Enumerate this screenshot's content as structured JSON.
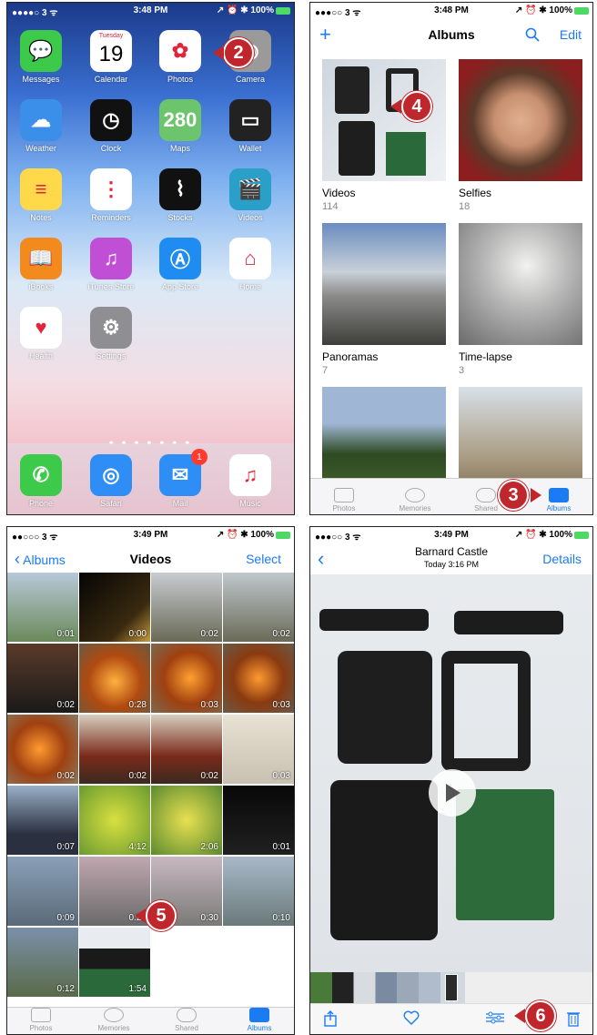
{
  "home": {
    "status": {
      "carrier": "●●●●○ 3 ᯤ",
      "time": "3:48 PM",
      "right": "↗ ⏰ ✱ 100%"
    },
    "apps": [
      {
        "label": "Messages",
        "icon": "messages-icon",
        "glyph": "💬",
        "color": "#3dc94a"
      },
      {
        "label": "Calendar",
        "icon": "calendar-icon",
        "glyph": "19",
        "color": "#ffffff"
      },
      {
        "label": "Photos",
        "icon": "photos-icon",
        "glyph": "✿",
        "color": "#ffffff"
      },
      {
        "label": "Camera",
        "icon": "camera-icon",
        "glyph": "◉",
        "color": "#9a9a9a"
      },
      {
        "label": "Weather",
        "icon": "weather-icon",
        "glyph": "☁",
        "color": "#3b8fe8"
      },
      {
        "label": "Clock",
        "icon": "clock-icon",
        "glyph": "◷",
        "color": "#111111"
      },
      {
        "label": "Maps",
        "icon": "maps-icon",
        "glyph": "280",
        "color": "#6cc56c"
      },
      {
        "label": "Wallet",
        "icon": "wallet-icon",
        "glyph": "▭",
        "color": "#222222"
      },
      {
        "label": "Notes",
        "icon": "notes-icon",
        "glyph": "≡",
        "color": "#ffd94a"
      },
      {
        "label": "Reminders",
        "icon": "reminders-icon",
        "glyph": "⋮",
        "color": "#ffffff"
      },
      {
        "label": "Stocks",
        "icon": "stocks-icon",
        "glyph": "⌇",
        "color": "#111111"
      },
      {
        "label": "Videos",
        "icon": "videos-icon",
        "glyph": "🎬",
        "color": "#2aa0c8"
      },
      {
        "label": "iBooks",
        "icon": "ibooks-icon",
        "glyph": "📖",
        "color": "#f38a1e"
      },
      {
        "label": "iTunes Store",
        "icon": "itunes-store-icon",
        "glyph": "♫",
        "color": "#c04fd6"
      },
      {
        "label": "App Store",
        "icon": "app-store-icon",
        "glyph": "Ⓐ",
        "color": "#1e8cf0"
      },
      {
        "label": "Home",
        "icon": "home-icon",
        "glyph": "⌂",
        "color": "#ffffff"
      },
      {
        "label": "Health",
        "icon": "health-icon",
        "glyph": "♥",
        "color": "#ffffff"
      },
      {
        "label": "Settings",
        "icon": "settings-icon",
        "glyph": "⚙",
        "color": "#8e8e93"
      }
    ],
    "page_dots": "● ● ● ● ● ● ●",
    "dock": [
      {
        "label": "Phone",
        "icon": "phone-icon",
        "glyph": "✆",
        "color": "#3dc94a"
      },
      {
        "label": "Safari",
        "icon": "safari-icon",
        "glyph": "◎",
        "color": "#2f8ef5"
      },
      {
        "label": "Mail",
        "icon": "mail-icon",
        "glyph": "✉",
        "color": "#2f8ef5",
        "badge": "1"
      },
      {
        "label": "Music",
        "icon": "music-icon",
        "glyph": "♫",
        "color": "#ffffff"
      }
    ],
    "calendar_day": "Tuesday",
    "callout": "2"
  },
  "albums": {
    "status": {
      "carrier": "●●●○○ 3 ᯤ",
      "time": "3:48 PM",
      "right": "↗ ⏰ ✱ 100%"
    },
    "nav": {
      "add": "+",
      "title": "Albums",
      "edit": "Edit"
    },
    "items": [
      {
        "name": "Videos",
        "count": "114"
      },
      {
        "name": "Selfies",
        "count": "18"
      },
      {
        "name": "Panoramas",
        "count": "7"
      },
      {
        "name": "Time-lapse",
        "count": "3"
      }
    ],
    "tabs": [
      "Photos",
      "Memories",
      "Shared",
      "Albums"
    ],
    "callouts": [
      "4",
      "3"
    ]
  },
  "videos": {
    "status": {
      "carrier": "●●○○○ 3 ᯤ",
      "time": "3:49 PM",
      "right": "↗ ⏰ ✱ 100%"
    },
    "nav": {
      "back": "Albums",
      "title": "Videos",
      "select": "Select"
    },
    "durations": [
      "0:01",
      "0:00",
      "0:02",
      "0:02",
      "0:02",
      "0:28",
      "0:03",
      "0:03",
      "0:02",
      "0:02",
      "0:02",
      "0:03",
      "0:07",
      "4:12",
      "2:06",
      "0:01",
      "0:09",
      "0:28",
      "0:30",
      "0:10",
      "0:12",
      "1:54"
    ],
    "tabs": [
      "Photos",
      "Memories",
      "Shared",
      "Albums"
    ],
    "callout": "5"
  },
  "detail": {
    "status": {
      "carrier": "●●●○○ 3 ᯤ",
      "time": "3:49 PM",
      "right": "↗ ⏰ ✱ 100%"
    },
    "nav": {
      "title": "Barnard Castle",
      "subtitle": "Today  3:16 PM",
      "details": "Details"
    },
    "callout": "6"
  }
}
